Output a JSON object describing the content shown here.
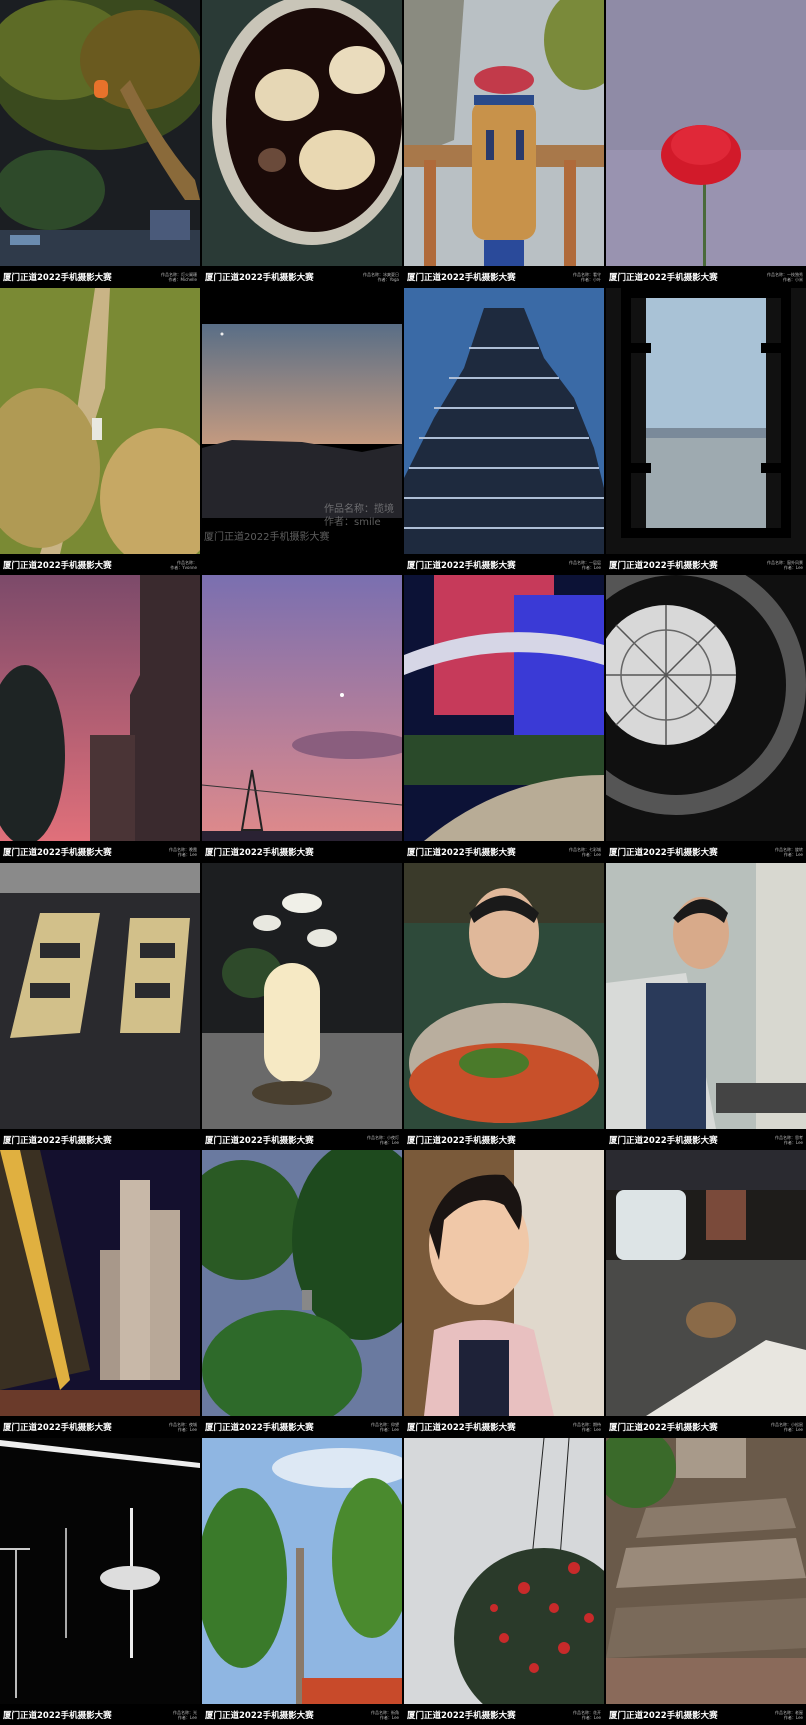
{
  "caption_title": "厦门正道2022手机摄影大赛",
  "cells": [
    {
      "name": "tree-lantern-street",
      "meta1": "作品名称：灯火阑珊",
      "meta2": "作者：Michelle"
    },
    {
      "name": "iced-cola-glass",
      "meta1": "作品名称：冰爽夏日",
      "meta2": "作者：Yoga"
    },
    {
      "name": "wooden-totem",
      "meta1": "作品名称：看守",
      "meta2": "作者：小叶"
    },
    {
      "name": "red-carnation",
      "meta1": "作品名称：一枝独秀",
      "meta2": "作者：小米"
    },
    {
      "name": "grass-hill-path",
      "meta1": "作品名称：",
      "meta2": "作者：Yvonne"
    },
    {
      "name": "dusk-mountain-silhouette",
      "meta1": "",
      "meta2": "",
      "overlay1": "作品名称：揽境",
      "overlay2": "作者：smile",
      "overlay3": "厦门正道2022手机摄影大赛"
    },
    {
      "name": "pagoda-building",
      "meta1": "作品名称：一层层",
      "meta2": "作者：Lee"
    },
    {
      "name": "window-lake-view",
      "meta1": "作品名称：窗外风景",
      "meta2": "作者：Lee"
    },
    {
      "name": "pink-sky-buildings",
      "meta1": "作品名称：晚霞",
      "meta2": "作者：Lee"
    },
    {
      "name": "purple-sky-moon",
      "meta1": "",
      "meta2": ""
    },
    {
      "name": "neon-building-night",
      "meta1": "作品名称：七彩城",
      "meta2": "作者：Lee"
    },
    {
      "name": "glass-dome-spiral",
      "meta1": "作品名称：旋转",
      "meta2": "作者：Lee"
    },
    {
      "name": "window-shadow-wall",
      "meta1": "",
      "meta2": ""
    },
    {
      "name": "lamp-flowers",
      "meta1": "作品名称：小夜灯",
      "meta2": "作者：Lee"
    },
    {
      "name": "man-eating-dish",
      "meta1": "",
      "meta2": ""
    },
    {
      "name": "man-at-laptop",
      "meta1": "作品名称：思考",
      "meta2": "作者：Lee"
    },
    {
      "name": "highrise-night",
      "meta1": "作品名称：夜城",
      "meta2": "作者：Lee"
    },
    {
      "name": "palm-trees-sky",
      "meta1": "作品名称：仰望",
      "meta2": "作者：Lee"
    },
    {
      "name": "child-looking-up",
      "meta1": "作品名称：期待",
      "meta2": "作者：Lee"
    },
    {
      "name": "squirrel-table",
      "meta1": "作品名称：小松鼠",
      "meta2": "作者：Lee"
    },
    {
      "name": "light-beams-dark",
      "meta1": "作品名称：光",
      "meta2": "作者：Lee"
    },
    {
      "name": "tree-pole-blue-sky",
      "meta1": "作品名称：街角",
      "meta2": "作者：Lee"
    },
    {
      "name": "red-flower-tree",
      "meta1": "作品名称：花开",
      "meta2": "作者：Lee"
    },
    {
      "name": "old-rooftops",
      "meta1": "作品名称：老屋",
      "meta2": "作者：Lee"
    }
  ]
}
